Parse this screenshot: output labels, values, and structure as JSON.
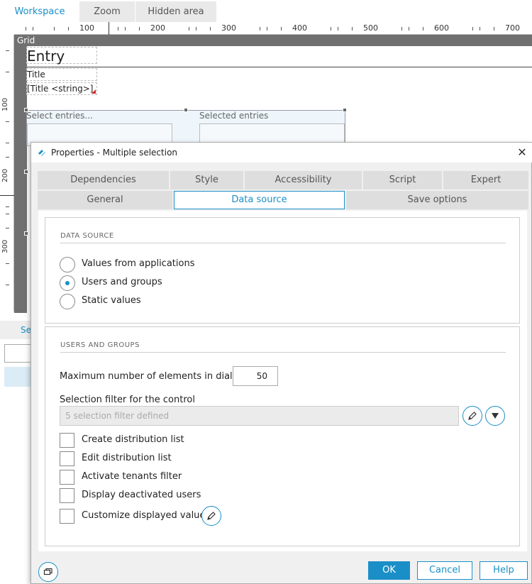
{
  "designer": {
    "tabs": [
      {
        "label": "Workspace",
        "active": true
      },
      {
        "label": "Zoom"
      },
      {
        "label": "Hidden area"
      }
    ],
    "ruler_h_labels": [
      "100",
      "200",
      "300",
      "400",
      "500",
      "600",
      "700"
    ],
    "ruler_v_labels": [
      "100",
      "200",
      "300"
    ],
    "grid_label": "Grid",
    "entry_title": "Entry",
    "title_label": "Title",
    "title_input": "[Title <string>]",
    "select_entries_label": "Select entries...",
    "selected_entries_label": "Selected entries",
    "bottom_tab_label": "Se"
  },
  "dialog": {
    "title": "Properties - Multiple selection",
    "tabs_row1": [
      "Dependencies",
      "Style",
      "Accessibility",
      "Script",
      "Expert"
    ],
    "tabs_row2": [
      "General",
      "Data source",
      "Save options"
    ],
    "active_tab": "Data source",
    "data_source": {
      "heading": "DATA SOURCE",
      "options": [
        {
          "label": "Values from applications",
          "checked": false
        },
        {
          "label": "Users and groups",
          "checked": true
        },
        {
          "label": "Static values",
          "checked": false
        }
      ]
    },
    "users_groups": {
      "heading": "USERS AND GROUPS",
      "max_label": "Maximum number of elements in dialog",
      "max_value": "50",
      "filter_label": "Selection filter for the control",
      "filter_placeholder": "5 selection filter defined",
      "checkboxes": [
        {
          "label": "Create distribution list",
          "checked": false
        },
        {
          "label": "Edit distribution list",
          "checked": false
        },
        {
          "label": "Activate tenants filter",
          "checked": false
        },
        {
          "label": "Display deactivated users",
          "checked": false
        },
        {
          "label": "Customize displayed values",
          "checked": false
        }
      ]
    },
    "footer": {
      "ok": "OK",
      "cancel": "Cancel",
      "help": "Help"
    },
    "colors": {
      "accent": "#1a8fc7",
      "tab_bg": "#dedede",
      "dialog_bg": "#f0f0f0"
    }
  }
}
